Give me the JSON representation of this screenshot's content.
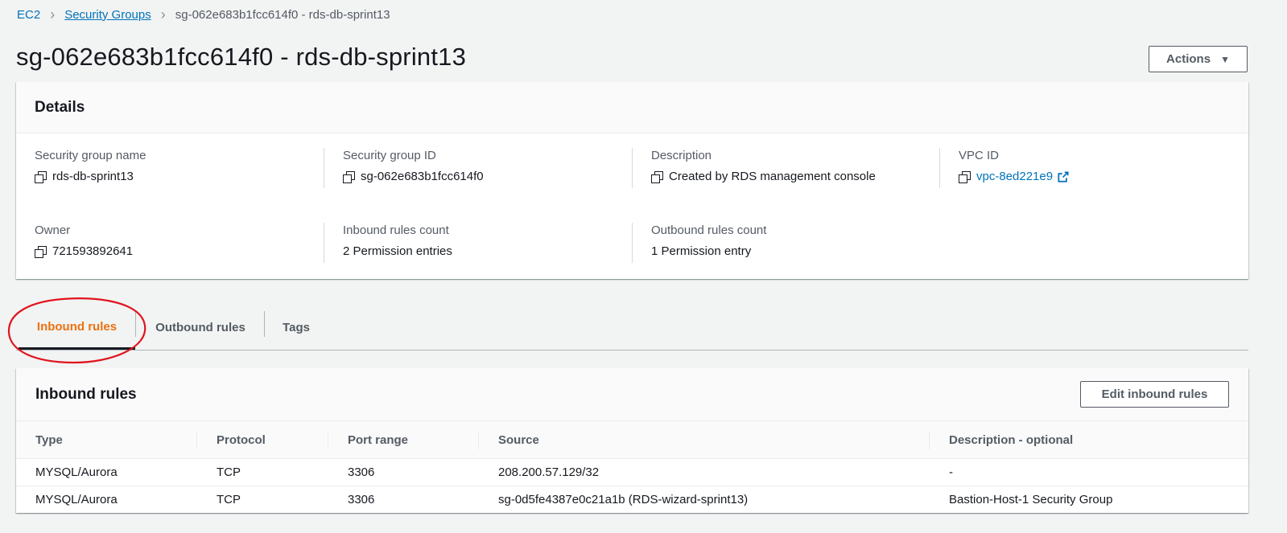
{
  "breadcrumb": {
    "root": "EC2",
    "parent": "Security Groups",
    "current": "sg-062e683b1fcc614f0 - rds-db-sprint13"
  },
  "page": {
    "title": "sg-062e683b1fcc614f0 - rds-db-sprint13",
    "actions_label": "Actions",
    "actions_caret": "▼"
  },
  "details": {
    "title": "Details",
    "fields": {
      "sg_name": {
        "label": "Security group name",
        "value": "rds-db-sprint13"
      },
      "sg_id": {
        "label": "Security group ID",
        "value": "sg-062e683b1fcc614f0"
      },
      "description": {
        "label": "Description",
        "value": "Created by RDS management console"
      },
      "vpc_id": {
        "label": "VPC ID",
        "value": "vpc-8ed221e9"
      },
      "owner": {
        "label": "Owner",
        "value": "721593892641"
      },
      "inbound_count": {
        "label": "Inbound rules count",
        "value": "2 Permission entries"
      },
      "outbound_count": {
        "label": "Outbound rules count",
        "value": "1 Permission entry"
      }
    }
  },
  "tabs": [
    {
      "label": "Inbound rules",
      "active": true
    },
    {
      "label": "Outbound rules",
      "active": false
    },
    {
      "label": "Tags",
      "active": false
    }
  ],
  "inbound": {
    "title": "Inbound rules",
    "edit_label": "Edit inbound rules",
    "columns": [
      "Type",
      "Protocol",
      "Port range",
      "Source",
      "Description - optional"
    ],
    "rows": [
      [
        "MYSQL/Aurora",
        "TCP",
        "3306",
        "208.200.57.129/32",
        "-"
      ],
      [
        "MYSQL/Aurora",
        "TCP",
        "3306",
        "sg-0d5fe4387e0c21a1b (RDS-wizard-sprint13)",
        "Bastion-Host-1 Security Group"
      ]
    ]
  },
  "colors": {
    "link": "#0073bb",
    "active_tab": "#ec7211",
    "annotation": "#e0141e"
  },
  "icons": [
    "chevron-right-icon",
    "caret-down-icon",
    "copy-icon",
    "external-link-icon"
  ]
}
